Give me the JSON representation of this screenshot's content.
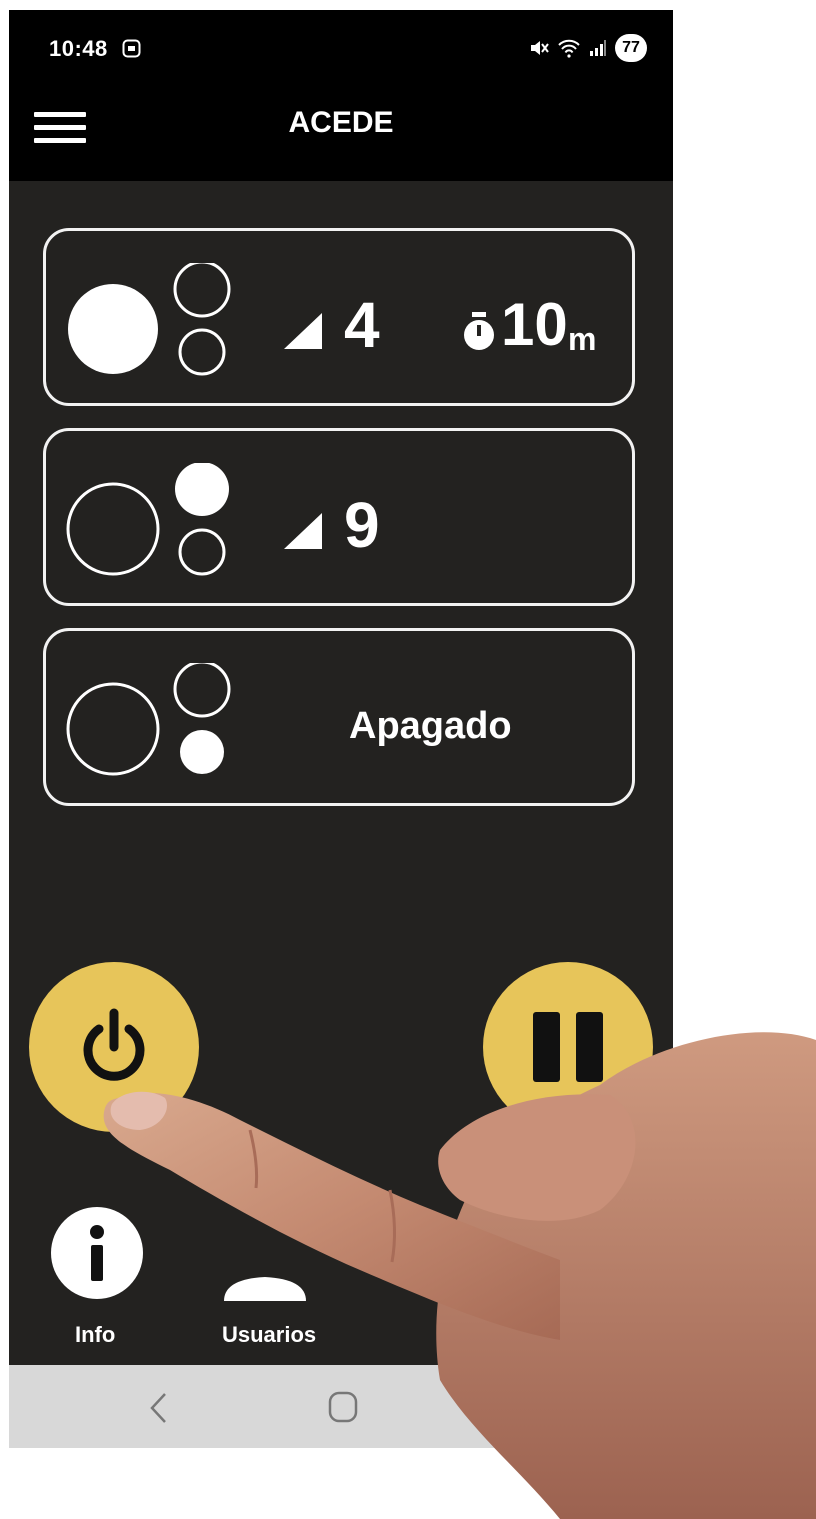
{
  "status_bar": {
    "time": "10:48",
    "battery": "77",
    "icons": [
      "screenshot-icon",
      "mute-icon",
      "wifi-icon",
      "signal-icon",
      "battery-icon"
    ]
  },
  "app_bar": {
    "title": "ACEDE",
    "menu_icon": "hamburger-menu-icon"
  },
  "programs": [
    {
      "indicator": [
        "filled",
        "outline",
        "outline"
      ],
      "intensity_icon": "intensity-wedge-icon",
      "intensity": "4",
      "timer_icon": "stopwatch-icon",
      "timer_value": "10",
      "timer_unit": "m"
    },
    {
      "indicator": [
        "outline",
        "filled",
        "outline"
      ],
      "intensity_icon": "intensity-wedge-icon",
      "intensity": "9"
    },
    {
      "indicator": [
        "outline",
        "outline",
        "filled"
      ],
      "status": "Apagado"
    }
  ],
  "actions": {
    "power_icon": "power-icon",
    "pause_icon": "pause-icon"
  },
  "bottom_nav": {
    "info_label": "Info",
    "users_label": "Usuarios"
  },
  "system_nav": {
    "back": "back-icon",
    "home": "home-icon"
  },
  "colors": {
    "background": "#232220",
    "bars": "#000000",
    "accent": "#e7c55a",
    "outline": "#f2f2f2",
    "system_nav": "#d8d8d8"
  }
}
